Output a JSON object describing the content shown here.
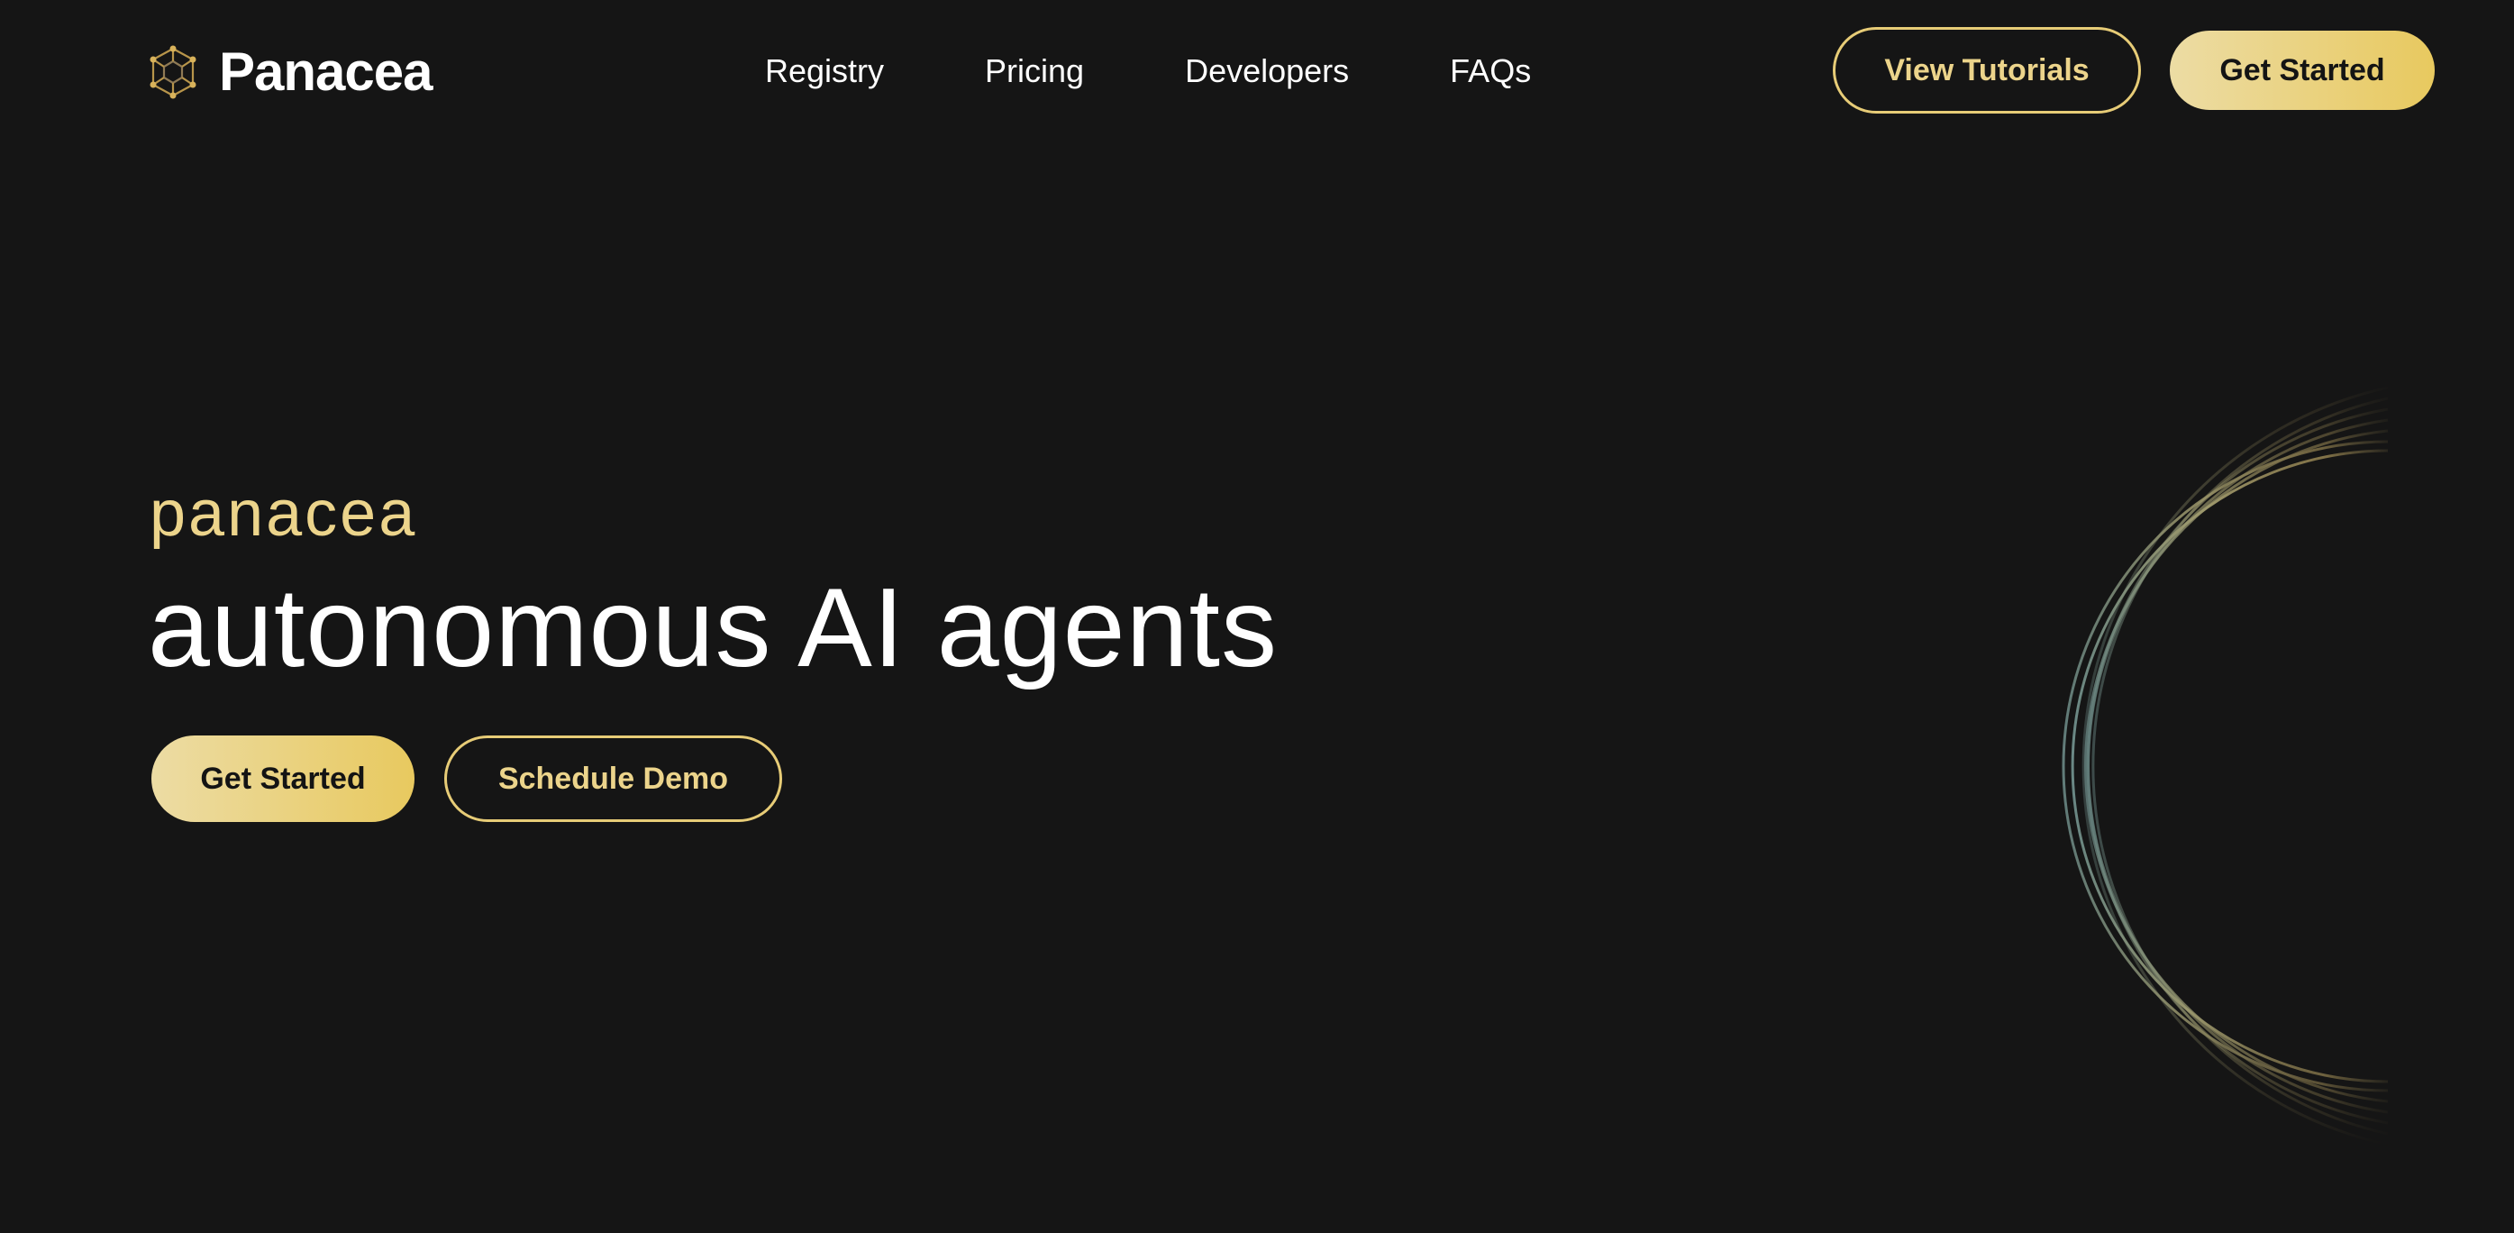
{
  "brand": {
    "name": "Panacea",
    "logo_icon": "hexagon-network-icon",
    "logo_color": "#c8a24a"
  },
  "nav": {
    "items": [
      {
        "label": "Registry"
      },
      {
        "label": "Pricing"
      },
      {
        "label": "Developers"
      },
      {
        "label": "FAQs"
      }
    ]
  },
  "header": {
    "tutorials_label": "View Tutorials",
    "get_started_label": "Get Started"
  },
  "hero": {
    "eyebrow": "panacea",
    "title": "autonomous AI agents",
    "get_started_label": "Get Started",
    "schedule_demo_label": "Schedule Demo"
  },
  "colors": {
    "background": "#151515",
    "accent_gold": "#ecd48b",
    "gradient_start": "#ecdca4",
    "gradient_end": "#e8c95f",
    "arc_teal": "#6f8f8c"
  }
}
